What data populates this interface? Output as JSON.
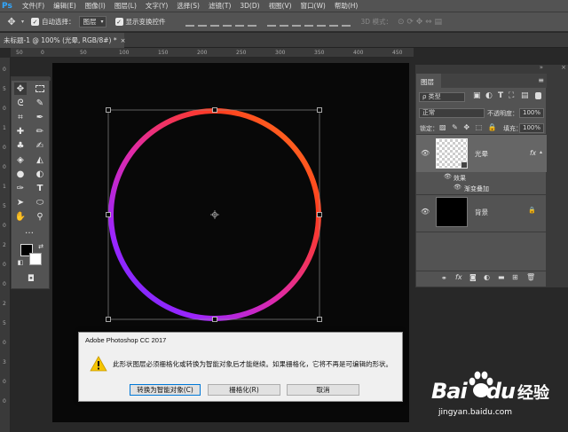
{
  "app": {
    "logo": "Ps",
    "accent": "#31a8ff"
  },
  "menu": [
    "文件(F)",
    "编辑(E)",
    "图像(I)",
    "图层(L)",
    "文字(Y)",
    "选择(S)",
    "滤镜(T)",
    "3D(D)",
    "视图(V)",
    "窗口(W)",
    "帮助(H)"
  ],
  "options": {
    "auto_select_label": "自动选择：",
    "auto_select_value": "图层",
    "show_transform_label": "显示变换控件",
    "mode_3d_label": "3D 模式："
  },
  "tab": {
    "title": "未标题-1 @ 100% (光晕, RGB/8#) *",
    "close": "×"
  },
  "ruler_h": [
    "50",
    "0",
    "50",
    "100",
    "150",
    "200",
    "250",
    "300",
    "350",
    "400",
    "450"
  ],
  "ruler_v": [
    "0",
    "5",
    "0",
    "1",
    "0",
    "0",
    "1",
    "5",
    "0",
    "2",
    "0",
    "0",
    "2",
    "5",
    "0",
    "3",
    "0",
    "0"
  ],
  "canvas": {
    "ring_colors": [
      "#ff8a1f",
      "#ff3b1f",
      "#e02aa8",
      "#9b25ff",
      "#5a30ff"
    ],
    "background": "#080808"
  },
  "layers_panel": {
    "title": "图层",
    "filter_label": "ρ 类型",
    "blend_mode": "正常",
    "opacity_label": "不透明度：",
    "opacity_value": "100%",
    "lock_label": "锁定：",
    "fill_label": "填充：",
    "fill_value": "100%",
    "layers": [
      {
        "name": "光晕",
        "fx": "fx",
        "effects_label": "效果",
        "effect": "渐变叠加"
      },
      {
        "name": "背景",
        "lock": "🔒"
      }
    ]
  },
  "dialog": {
    "title": "Adobe Photoshop CC 2017",
    "message": "此形状图层必须栅格化或转换为智能对象后才能继续。如果栅格化，它将不再是可编辑的形状。",
    "btn_smart": "转换为智能对象(C)",
    "btn_rasterize": "栅格化(R)",
    "btn_cancel": "取消"
  },
  "watermark": {
    "brand": "Bai",
    "brand2": "du",
    "jingyan": "经验",
    "url": "jingyan.baidu.com"
  }
}
